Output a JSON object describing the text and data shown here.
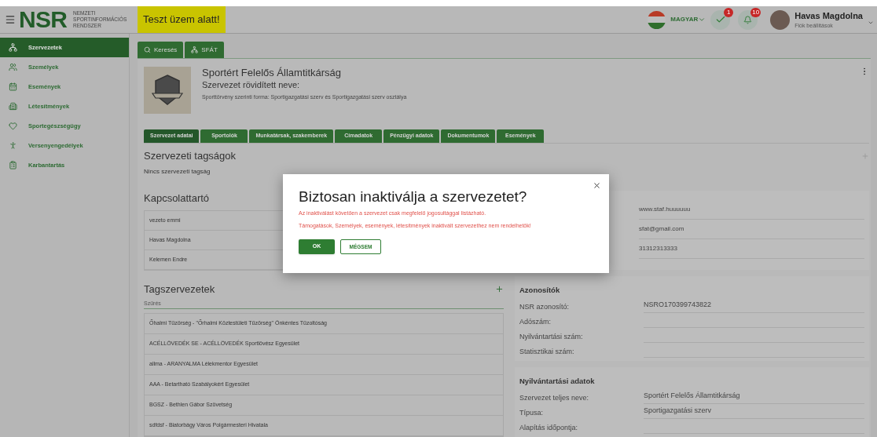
{
  "header": {
    "logo": "NSR",
    "logo_subtitle": [
      "NEMZETI",
      "SPORTINFORMÁCIÓS",
      "RENDSZER"
    ],
    "test_banner": "Teszt üzem alatt!",
    "language": "MAGYAR",
    "tasks_badge": "1",
    "notifications_badge": "10",
    "user_name": "Havas Magdolna",
    "user_subtitle": "Fiók beállítások"
  },
  "sidebar": {
    "items": [
      {
        "label": "Szervezetek",
        "selected": true
      },
      {
        "label": "Személyek",
        "selected": false
      },
      {
        "label": "Események",
        "selected": false
      },
      {
        "label": "Létesítmények",
        "selected": false
      },
      {
        "label": "Sportegészségügy",
        "selected": false
      },
      {
        "label": "Versenyengedélyek",
        "selected": false
      },
      {
        "label": "Karbantartás",
        "selected": false
      }
    ]
  },
  "top_tabs": [
    {
      "label": "Keresés"
    },
    {
      "label": "SFÁT"
    }
  ],
  "organization": {
    "name": "Sportért Felelős Államtitkárság",
    "short_name_label": "Szervezet rövidített neve:",
    "form": "Sporttörvény szerinti forma: Sportigazgatási szerv és Sportigazgatási szerv osztálya"
  },
  "tabs": [
    {
      "label": "Szervezet adatai",
      "selected": true
    },
    {
      "label": "Sportolók",
      "selected": false
    },
    {
      "label": "Munkatársak, szakemberek",
      "selected": false
    },
    {
      "label": "Címadatok",
      "selected": false
    },
    {
      "label": "Pénzügyi adatok",
      "selected": false
    },
    {
      "label": "Dokumentumok",
      "selected": false
    },
    {
      "label": "Események",
      "selected": false
    }
  ],
  "memberships": {
    "title": "Szervezeti tagságok",
    "empty_text": "Nincs szervezeti tagság"
  },
  "contacts": {
    "title": "Kapcsolattartó",
    "rows": [
      "vezeto emmi",
      "Havas Magdolna",
      "Kelemen Endre"
    ]
  },
  "contact_info": [
    "www.staf.huuuuuu",
    "sfat@gmail.com",
    "31312313333"
  ],
  "member_orgs": {
    "title": "Tagszervezetek",
    "filter_placeholder": "Szűrés",
    "rows": [
      "Őhalmi Tűzörség - \"Őrhalmi Köztestületi Tűzőrség\" Önkéntes Tűzoltóság",
      "ACÉLLÖVEDÉK SE - ACÉLLÖVEDÉK Sportlövész Egyesület",
      "allma - ARANYALMA Lélekmentor Egyesület",
      "AAA - Betartható Szabályokért Egyesület",
      "BGSZ - Bethlen Gábor Szövetség",
      "sdfdsf - Biatorbágy Város Polgármesteri Hivatala"
    ]
  },
  "identifiers": {
    "title": "Azonosítók",
    "rows": [
      {
        "label": "NSR azonosító:",
        "value": "NSRO170399743822"
      },
      {
        "label": "Adószám:"
      },
      {
        "label": "Nyilvántartási szám:"
      },
      {
        "label": "Statisztikai szám:"
      }
    ]
  },
  "registry": {
    "title": "Nyilvántartási adatok",
    "rows": [
      {
        "label": "Szervezet teljes neve:",
        "value": "Sportért Felelős Államtitkárság"
      },
      {
        "label": "Típusa:",
        "value": "Sportigazgatási szerv"
      },
      {
        "label": "Alapítás időpontja:"
      }
    ]
  },
  "dialog": {
    "title": "Biztosan inaktiválja a szervezetet?",
    "messages": [
      "Az inaktiválást követően a szervezet csak megfelelő jogosultággal listázható.",
      "Támogatások, Személyek, események, létesítmények inaktivált szervezethez nem rendelhetők!"
    ],
    "ok": "OK",
    "cancel": "MÉGSEM"
  }
}
